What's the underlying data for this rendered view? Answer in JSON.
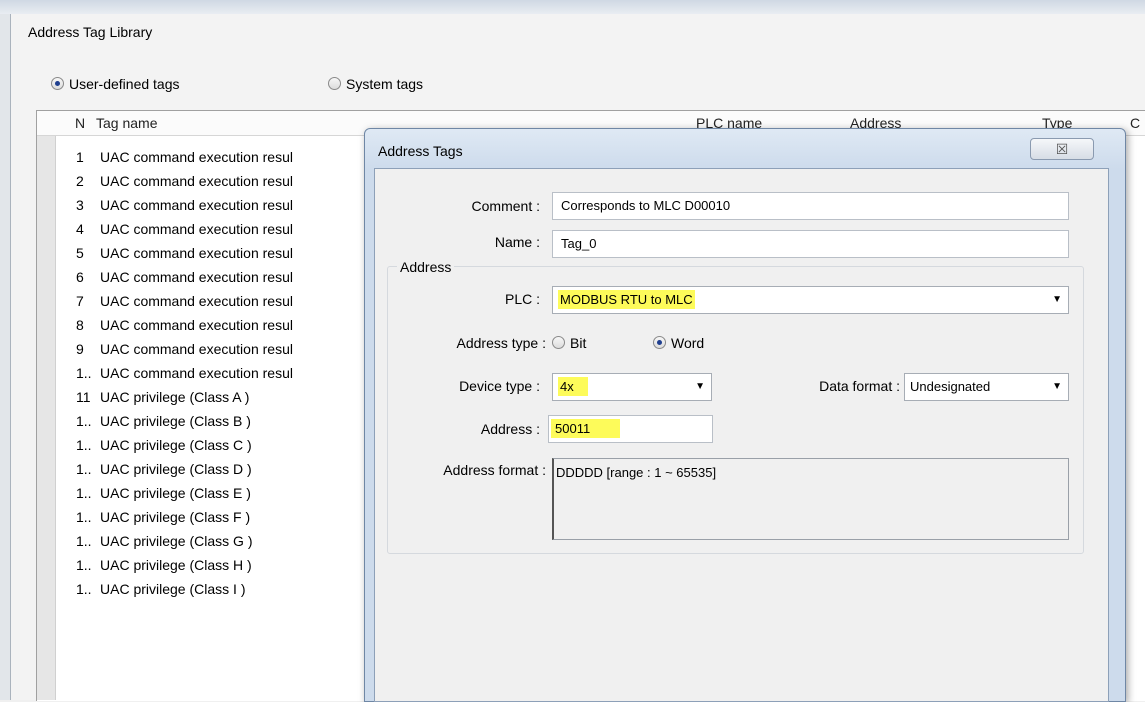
{
  "main": {
    "title": "Address Tag Library",
    "radio_user": "User-defined tags",
    "radio_system": "System tags",
    "columns": {
      "n": "N",
      "tag_name": "Tag name",
      "plc_name": "PLC name",
      "address": "Address",
      "type": "Type",
      "c": "C"
    },
    "rows": [
      {
        "n": "1",
        "name": "UAC command execution resul"
      },
      {
        "n": "2",
        "name": "UAC command execution resul"
      },
      {
        "n": "3",
        "name": "UAC command execution resul"
      },
      {
        "n": "4",
        "name": "UAC command execution resul"
      },
      {
        "n": "5",
        "name": "UAC command execution resul"
      },
      {
        "n": "6",
        "name": "UAC command execution resul"
      },
      {
        "n": "7",
        "name": "UAC command execution resul"
      },
      {
        "n": "8",
        "name": "UAC command execution resul"
      },
      {
        "n": "9",
        "name": "UAC command execution resul"
      },
      {
        "n": "1..",
        "name": "UAC command execution resul"
      },
      {
        "n": "11",
        "name": "UAC privilege (Class A )"
      },
      {
        "n": "1..",
        "name": "UAC privilege (Class B )"
      },
      {
        "n": "1..",
        "name": "UAC privilege (Class C )"
      },
      {
        "n": "1..",
        "name": "UAC privilege (Class D )"
      },
      {
        "n": "1..",
        "name": "UAC privilege (Class E )"
      },
      {
        "n": "1..",
        "name": "UAC privilege (Class F )"
      },
      {
        "n": "1..",
        "name": "UAC privilege (Class G )"
      },
      {
        "n": "1..",
        "name": "UAC privilege (Class H )"
      },
      {
        "n": "1..",
        "name": "UAC privilege (Class I )"
      }
    ]
  },
  "dialog": {
    "title": "Address Tags",
    "close_glyph": "☒",
    "comment_label": "Comment :",
    "comment_value": "Corresponds to MLC D00010",
    "name_label": "Name :",
    "name_value": "Tag_0",
    "address_group": "Address",
    "plc_label": "PLC :",
    "plc_value": "MODBUS RTU to MLC",
    "addr_type_label": "Address type :",
    "addr_type_bit": "Bit",
    "addr_type_word": "Word",
    "device_type_label": "Device type :",
    "device_type_value": "4x",
    "data_format_label": "Data format :",
    "data_format_value": "Undesignated",
    "address_label": "Address :",
    "address_value": "50011",
    "address_format_label": "Address format :",
    "address_format_value": "DDDDD [range : 1 ~ 65535]"
  },
  "colors": {
    "highlight": "#fdfb5a",
    "dialog_frame": "#cddbec"
  }
}
